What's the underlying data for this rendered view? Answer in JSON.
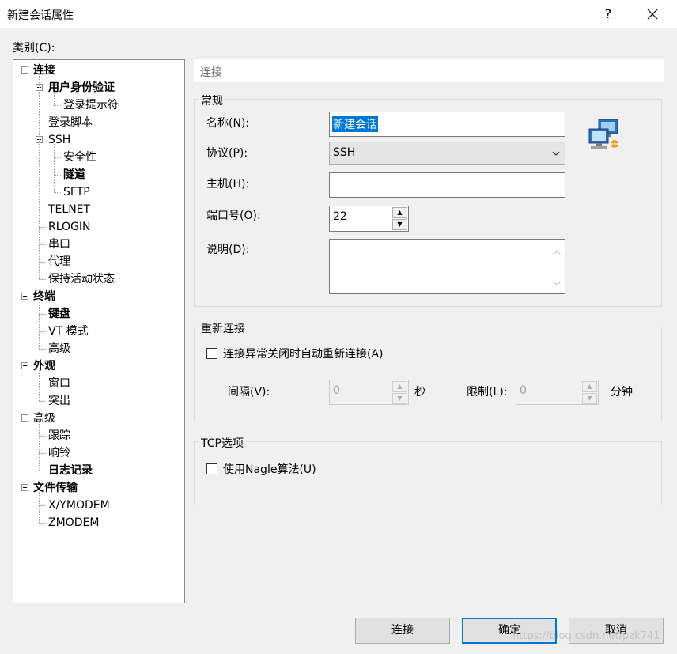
{
  "window": {
    "title": "新建会话属性",
    "help": "?"
  },
  "category_label": "类别(C):",
  "tree": [
    {
      "label": "连接",
      "bold": true,
      "level": 0,
      "expander": true
    },
    {
      "label": "用户身份验证",
      "bold": true,
      "level": 1,
      "expander": true
    },
    {
      "label": "登录提示符",
      "bold": false,
      "level": 2,
      "expander": false
    },
    {
      "label": "登录脚本",
      "bold": false,
      "level": 1,
      "expander": false
    },
    {
      "label": "SSH",
      "bold": false,
      "level": 1,
      "expander": true
    },
    {
      "label": "安全性",
      "bold": false,
      "level": 2,
      "expander": false
    },
    {
      "label": "隧道",
      "bold": true,
      "level": 2,
      "expander": false
    },
    {
      "label": "SFTP",
      "bold": false,
      "level": 2,
      "expander": false
    },
    {
      "label": "TELNET",
      "bold": false,
      "level": 1,
      "expander": false
    },
    {
      "label": "RLOGIN",
      "bold": false,
      "level": 1,
      "expander": false
    },
    {
      "label": "串口",
      "bold": false,
      "level": 1,
      "expander": false
    },
    {
      "label": "代理",
      "bold": false,
      "level": 1,
      "expander": false
    },
    {
      "label": "保持活动状态",
      "bold": false,
      "level": 1,
      "expander": false
    },
    {
      "label": "终端",
      "bold": true,
      "level": 0,
      "expander": true
    },
    {
      "label": "键盘",
      "bold": true,
      "level": 1,
      "expander": false
    },
    {
      "label": "VT 模式",
      "bold": false,
      "level": 1,
      "expander": false
    },
    {
      "label": "高级",
      "bold": false,
      "level": 1,
      "expander": false
    },
    {
      "label": "外观",
      "bold": true,
      "level": 0,
      "expander": true
    },
    {
      "label": "窗口",
      "bold": false,
      "level": 1,
      "expander": false
    },
    {
      "label": "突出",
      "bold": false,
      "level": 1,
      "expander": false
    },
    {
      "label": "高级",
      "bold": false,
      "level": 0,
      "expander": true
    },
    {
      "label": "跟踪",
      "bold": false,
      "level": 1,
      "expander": false
    },
    {
      "label": "响铃",
      "bold": false,
      "level": 1,
      "expander": false
    },
    {
      "label": "日志记录",
      "bold": true,
      "level": 1,
      "expander": false
    },
    {
      "label": "文件传输",
      "bold": true,
      "level": 0,
      "expander": true
    },
    {
      "label": "X/YMODEM",
      "bold": false,
      "level": 1,
      "expander": false
    },
    {
      "label": "ZMODEM",
      "bold": false,
      "level": 1,
      "expander": false
    }
  ],
  "panel": {
    "header": "连接",
    "general": {
      "title": "常规",
      "name_label": "名称(N):",
      "name_value": "新建会话",
      "protocol_label": "协议(P):",
      "protocol_value": "SSH",
      "host_label": "主机(H):",
      "host_value": "",
      "port_label": "端口号(O):",
      "port_value": "22",
      "desc_label": "说明(D):",
      "desc_value": ""
    },
    "reconnect": {
      "title": "重新连接",
      "checkbox_label": "连接异常关闭时自动重新连接(A)",
      "checked": false,
      "interval_label": "间隔(V):",
      "interval_value": "0",
      "interval_unit": "秒",
      "limit_label": "限制(L):",
      "limit_value": "0",
      "limit_unit": "分钟"
    },
    "tcp": {
      "title": "TCP选项",
      "nagle_label": "使用Nagle算法(U)",
      "checked": false
    }
  },
  "buttons": {
    "connect": "连接",
    "ok": "确定",
    "cancel": "取消"
  },
  "watermark": "https://blog.csdn.net/pzk741",
  "colors": {
    "accent": "#0078d7",
    "background": "#f0f0f0"
  },
  "icons": {
    "session": "network-computers-icon"
  }
}
